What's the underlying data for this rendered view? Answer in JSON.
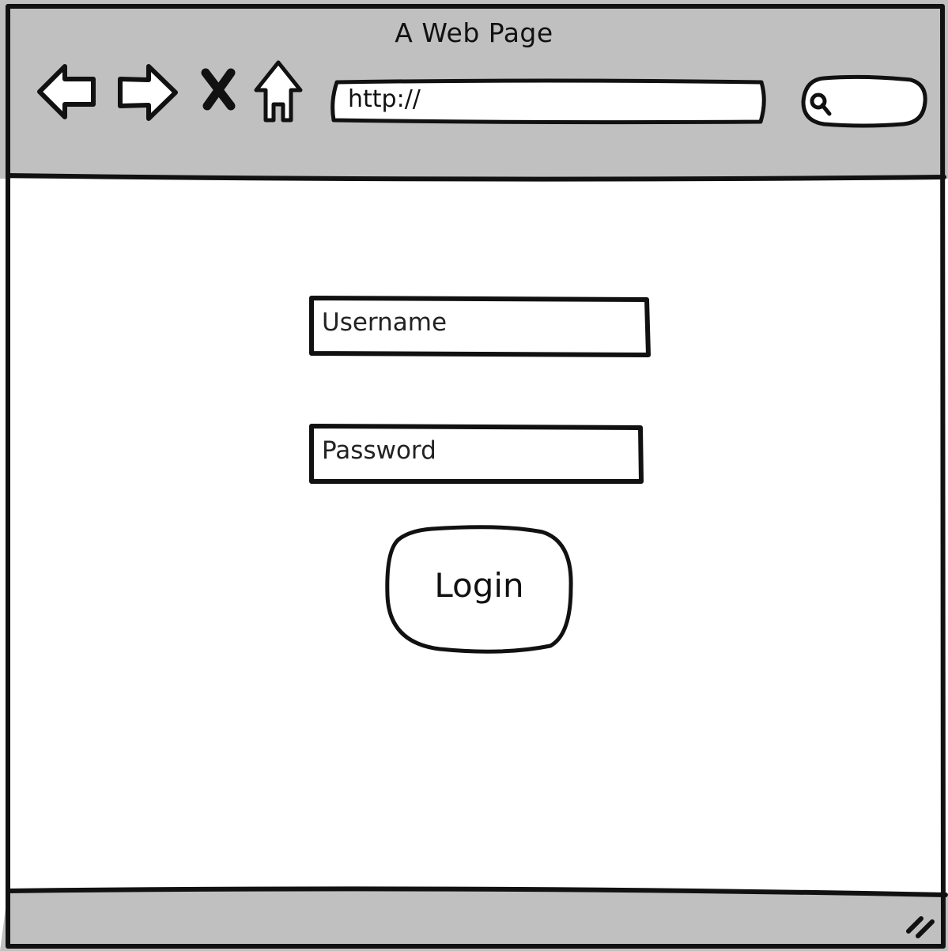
{
  "window": {
    "title": "A Web Page",
    "chrome_color": "#c0c0c0",
    "border_color": "#111111"
  },
  "toolbar": {
    "back_icon": "back-arrow-icon",
    "forward_icon": "forward-arrow-icon",
    "stop_icon": "close-icon",
    "home_icon": "home-icon",
    "url_value": "http://",
    "search_icon": "search-icon"
  },
  "login_form": {
    "username_placeholder": "Username",
    "password_placeholder": "Password",
    "login_label": "Login"
  },
  "status_bar": {
    "grip_icon": "resize-grip-icon"
  }
}
